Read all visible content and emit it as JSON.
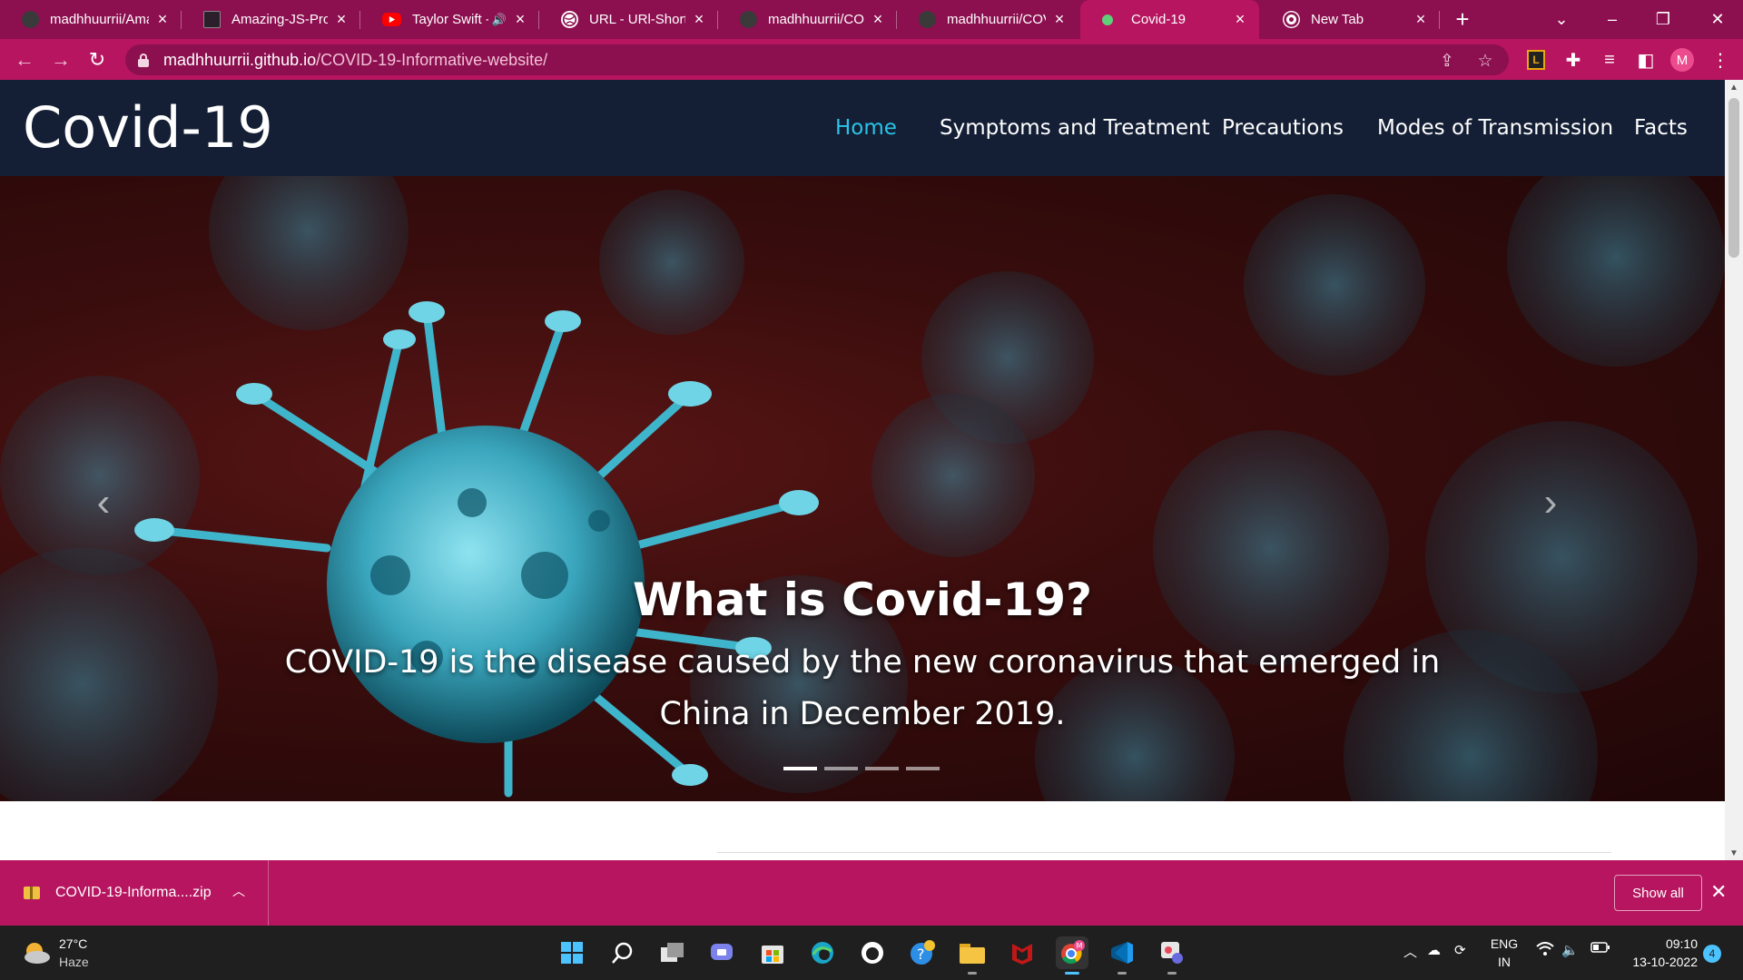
{
  "browser": {
    "tabs": [
      {
        "title": "madhhuurrii/Ama",
        "favicon": "github-icon",
        "active": false
      },
      {
        "title": "Amazing-JS-Proje",
        "favicon": "project-icon",
        "active": false
      },
      {
        "title": "Taylor Swift -",
        "favicon": "youtube-icon",
        "active": false,
        "audio": true
      },
      {
        "title": "URL - URl-Shortn",
        "favicon": "globe-icon",
        "active": false
      },
      {
        "title": "madhhuurrii/COV",
        "favicon": "github-icon",
        "active": false
      },
      {
        "title": "madhhuurrii/COV",
        "favicon": "github-icon",
        "active": false
      },
      {
        "title": "Covid-19",
        "favicon": "green-dot-icon",
        "active": true
      },
      {
        "title": "New Tab",
        "favicon": "chrome-icon",
        "active": false
      }
    ],
    "url_host": "madhhuurrii.github.io",
    "url_path": "/COVID-19-Informative-website/",
    "profile_initial": "M",
    "extension_letter": "L",
    "accent_color": "#b7155f",
    "tabstrip_color": "#8c0f4f"
  },
  "site": {
    "brand": "Covid-19",
    "nav": [
      {
        "label": "Home",
        "active": true
      },
      {
        "label": "Symptoms and Treatment",
        "active": false
      },
      {
        "label": "Precautions",
        "active": false
      },
      {
        "label": "Modes of Transmission",
        "active": false
      },
      {
        "label": "Facts",
        "active": false
      }
    ],
    "nav_bg": "#141f35",
    "nav_active_color": "#29c4e8",
    "hero": {
      "title": "What is Covid-19?",
      "text": "COVID-19 is the disease caused by the new coronavirus that emerged in China in December 2019.",
      "slide_count": 4,
      "active_slide": 1,
      "prev_glyph": "‹",
      "next_glyph": "›"
    }
  },
  "downloads": {
    "file_name": "COVID-19-Informa....zip",
    "show_all": "Show all"
  },
  "taskbar": {
    "temperature": "27°C",
    "condition": "Haze",
    "lang_top": "ENG",
    "lang_bottom": "IN",
    "time": "09:10",
    "date": "13-10-2022",
    "notification_count": "4",
    "profile_badge": "M"
  }
}
